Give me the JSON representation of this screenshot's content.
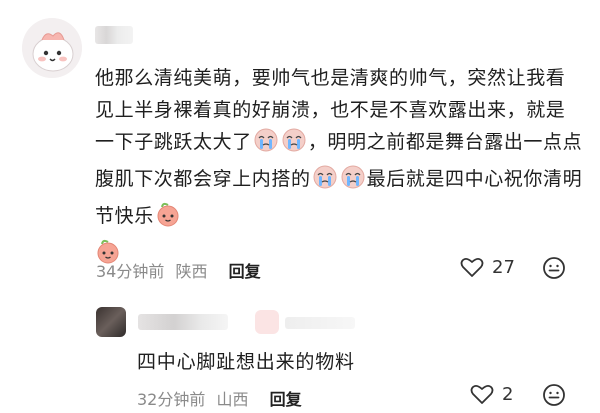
{
  "comment": {
    "text_part1": "他那么清纯美萌，要帅气也是清爽的帅气，突然让我看见上半身裸着真的好崩溃，也不是不喜欢露出来，就是一下子跳跃太大了",
    "text_part2": "，明明之前都是舞台露出一点点腹肌下次都会穿上内搭的",
    "text_part3": "最后就是四中心祝你清明节快乐",
    "time": "34分钟前",
    "location": "陕西",
    "reply_label": "回复",
    "likes": "27",
    "icons": [
      "heart-outline-icon",
      "comment-bubble-icon",
      "crying-emoji-icon",
      "peach-emoji-icon"
    ]
  },
  "reply": {
    "text": "四中心脚趾想出来的物料",
    "time": "32分钟前",
    "location": "山西",
    "reply_label": "回复",
    "likes": "2"
  },
  "colors": {
    "text": "#1f1f1f",
    "meta": "#8a8a8a",
    "peach": "#f6a494"
  }
}
